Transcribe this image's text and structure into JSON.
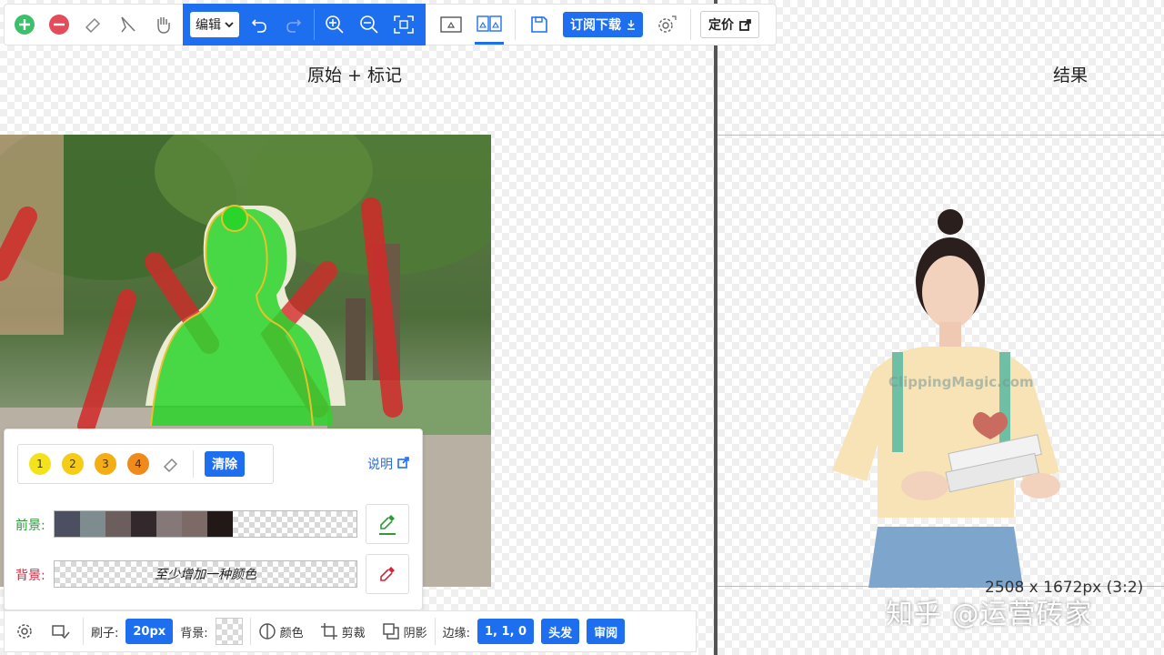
{
  "toolbar": {
    "mode_select": "编辑",
    "subscribe_label": "订阅下载",
    "pricing_label": "定价"
  },
  "left_pane": {
    "title": "原始 + 标记"
  },
  "right_pane": {
    "title": "结果",
    "size_text": "2508 x 1672px (3:2)",
    "logo_watermark": "ClippingMagic.com"
  },
  "brush_panel": {
    "sizes": [
      "1",
      "2",
      "3",
      "4"
    ],
    "clear_label": "清除",
    "help_label": "说明",
    "foreground_label": "前景:",
    "background_label": "背景:",
    "background_hint": "至少增加一种颜色",
    "foreground_colors": [
      "#4b4f60",
      "#7e8c90",
      "#6b5e5c",
      "#33292c",
      "#857878",
      "#7b6a66",
      "#221817"
    ]
  },
  "bottombar": {
    "brush_label": "刷子:",
    "brush_value": "20px",
    "bg_label": "背景:",
    "color_label": "颜色",
    "crop_label": "剪裁",
    "shadow_label": "阴影",
    "edge_label": "边缘:",
    "edge_value": "1, 1, 0",
    "hair_label": "头发",
    "review_label": "审阅"
  },
  "overlay_watermark": "知乎 @运营砖家",
  "colors": {
    "accent": "#1e6ff0",
    "foreground_mark": "#2bd42b",
    "background_mark": "#d32a2a",
    "add_icon": "#3cc06a",
    "remove_icon": "#e34c5a"
  }
}
